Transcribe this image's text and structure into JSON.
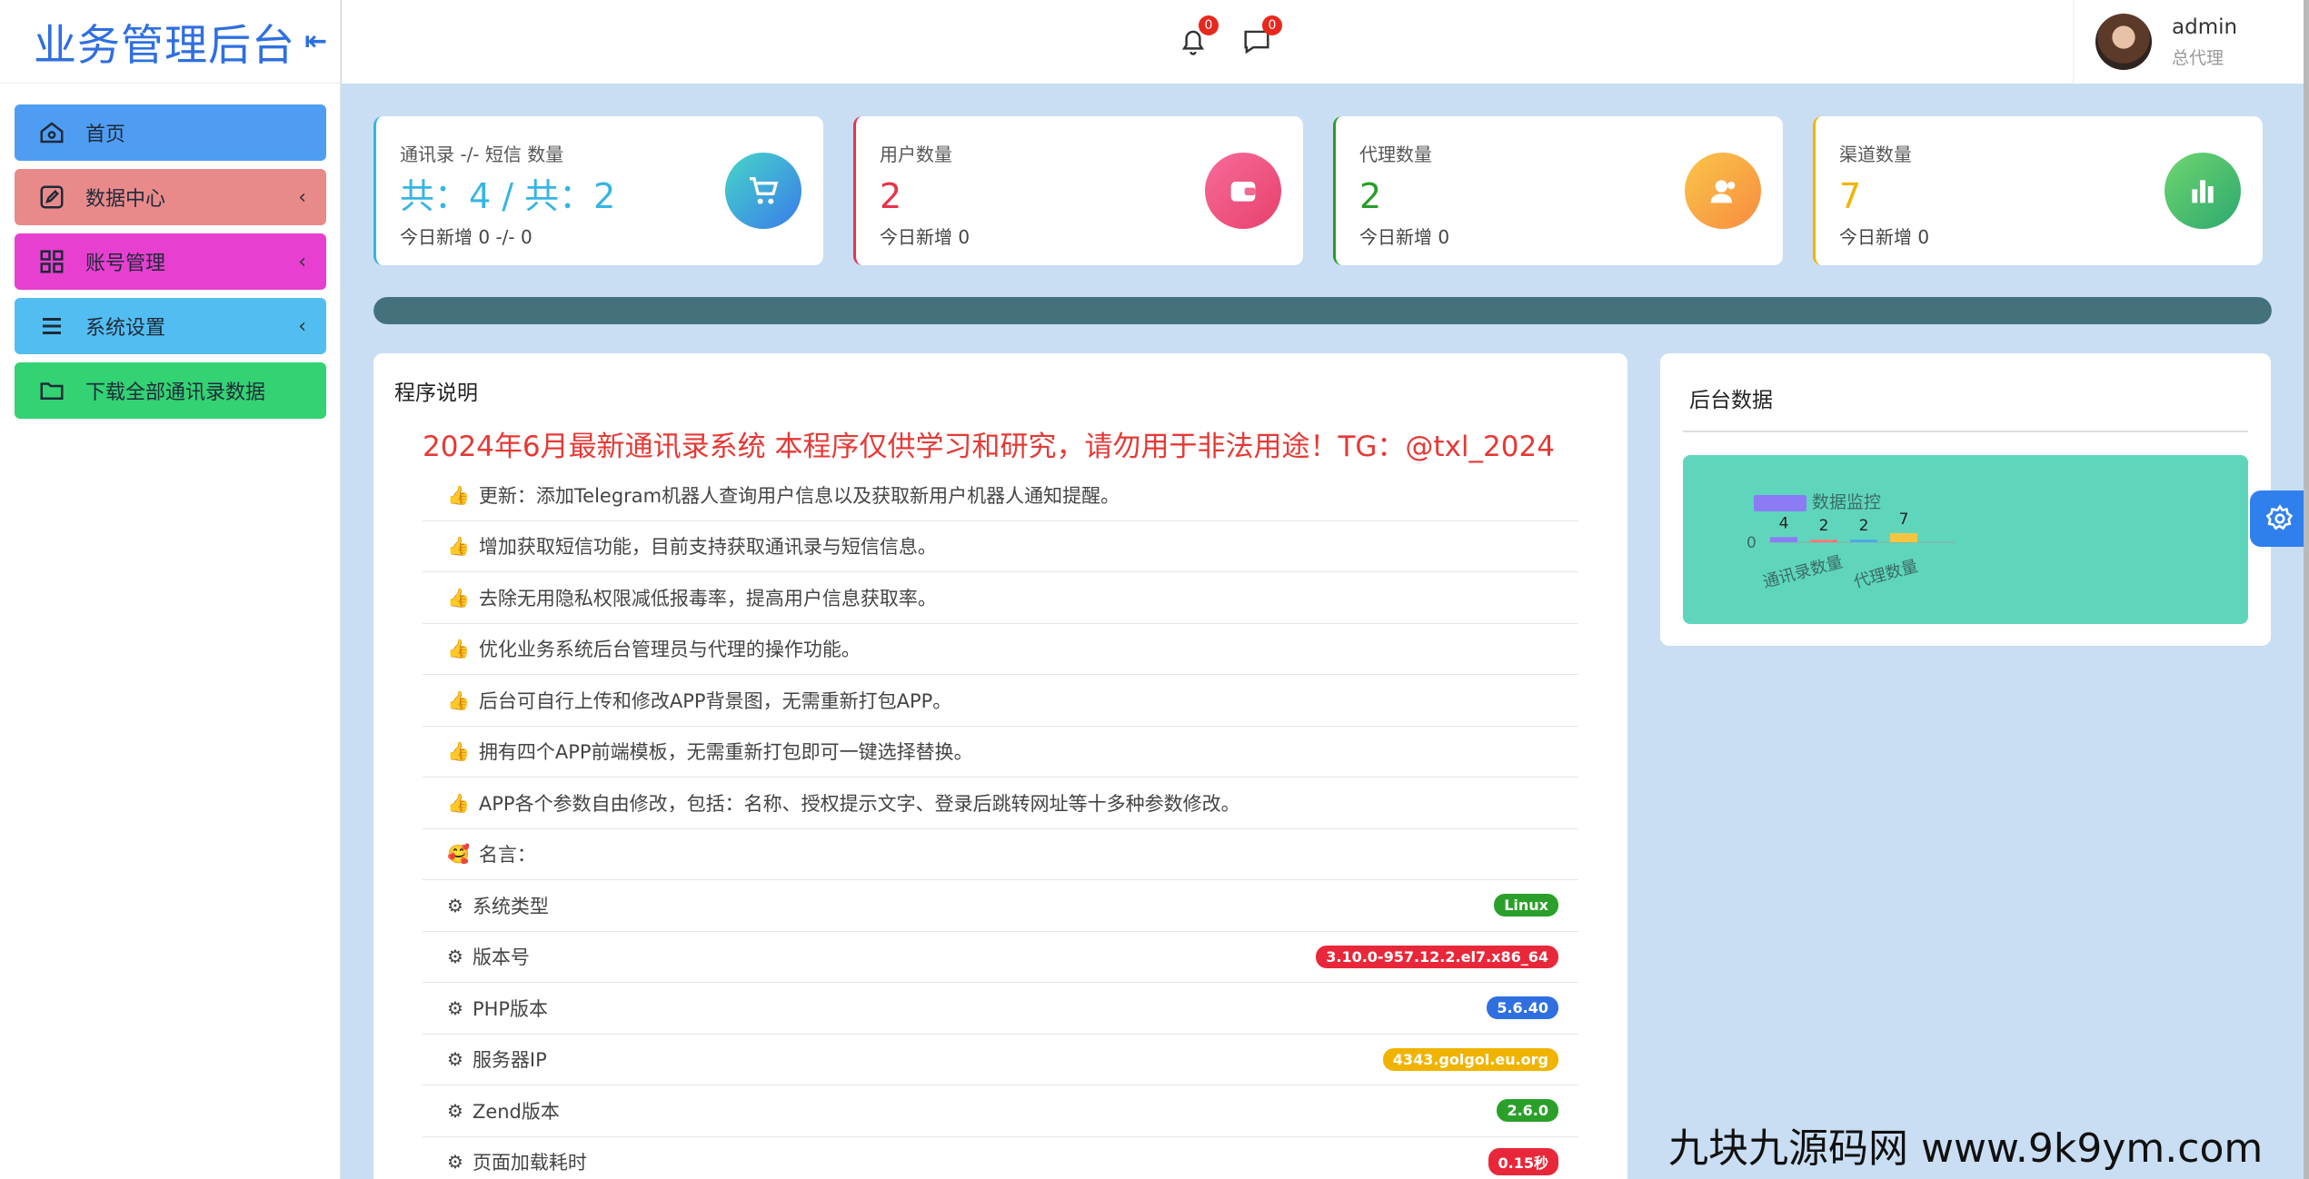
{
  "brand": {
    "title": "业务管理后台",
    "collapse_icon": "collapse-left-icon"
  },
  "sidebar": {
    "items": [
      {
        "label": "首页",
        "icon": "home-icon",
        "color": "#4f9df3",
        "has_arrow": false
      },
      {
        "label": "数据中心",
        "icon": "edit-icon",
        "color": "#e98a8a",
        "has_arrow": true
      },
      {
        "label": "账号管理",
        "icon": "grid-icon",
        "color": "#e73fcf",
        "has_arrow": true
      },
      {
        "label": "系统设置",
        "icon": "menu-icon",
        "color": "#52bdf0",
        "has_arrow": true
      },
      {
        "label": "下载全部通讯录数据",
        "icon": "folder-icon",
        "color": "#33d273",
        "has_arrow": false
      }
    ],
    "arrow_glyph": "‹"
  },
  "header": {
    "notifications": {
      "count": "0",
      "icon": "bell-icon"
    },
    "messages": {
      "count": "0",
      "icon": "chat-icon"
    },
    "user": {
      "name": "admin",
      "role": "总代理"
    }
  },
  "cards": [
    {
      "label": "通讯录 -/- 短信 数量",
      "value": "共：4 / 共：2",
      "sub": "今日新增 0 -/- 0",
      "color": "#36b5e3",
      "icon": "cart-icon"
    },
    {
      "label": "用户数量",
      "value": "2",
      "sub": "今日新增 0",
      "color": "#e8334a",
      "icon": "wallet-icon"
    },
    {
      "label": "代理数量",
      "value": "2",
      "sub": "今日新增 0",
      "color": "#2a9d2a",
      "icon": "users-icon"
    },
    {
      "label": "渠道数量",
      "value": "7",
      "sub": "今日新增 0",
      "color": "#f0b400",
      "icon": "bar-chart-icon"
    }
  ],
  "progress": {
    "percent": 100,
    "color": "#44727c"
  },
  "program": {
    "title": "程序说明",
    "notice": "2024年6月最新通讯录系统 本程序仅供学习和研究，请勿用于非法用途！TG：@txl_2024",
    "features": [
      "更新：添加Telegram机器人查询用户信息以及获取新用户机器人通知提醒。",
      "增加获取短信功能，目前支持获取通讯录与短信信息。",
      "去除无用隐私权限减低报毒率，提高用户信息获取率。",
      "优化业务系统后台管理员与代理的操作功能。",
      "后台可自行上传和修改APP背景图，无需重新打包APP。",
      "拥有四个APP前端模板，无需重新打包即可一键选择替换。",
      "APP各个参数自由修改，包括：名称、授权提示文字、登录后跳转网址等十多种参数修改。"
    ],
    "quote_label": "名言：",
    "system_info": [
      {
        "label": "系统类型",
        "value": "Linux",
        "color": "#2aa02a"
      },
      {
        "label": "版本号",
        "value": "3.10.0-957.12.2.el7.x86_64",
        "color": "#e8283a"
      },
      {
        "label": "PHP版本",
        "value": "5.6.40",
        "color": "#2f6fe0"
      },
      {
        "label": "服务器IP",
        "value": "4343.golgol.eu.org",
        "color": "#f0b400"
      },
      {
        "label": "Zend版本",
        "value": "2.6.0",
        "color": "#2aa02a"
      },
      {
        "label": "页面加载耗时",
        "value": "0.15秒",
        "color": "#e8283a"
      }
    ]
  },
  "backend": {
    "title": "后台数据",
    "chart_bg": "#5fd6bc"
  },
  "chart_data": {
    "type": "bar",
    "title": "数据监控",
    "categories": [
      "通讯录数量",
      "",
      "代理数量",
      "",
      ""
    ],
    "tick_labels": [
      "通讯录数量",
      "代理数量"
    ],
    "values": [
      4,
      2,
      2,
      7
    ],
    "colors": [
      "#8b7cf6",
      "#ff7a7a",
      "#4aa8e8",
      "#f5c542"
    ],
    "ylabel": "",
    "y_tick": "0",
    "legend": "top"
  },
  "watermark": "九块九源码网 www.9k9ym.com"
}
